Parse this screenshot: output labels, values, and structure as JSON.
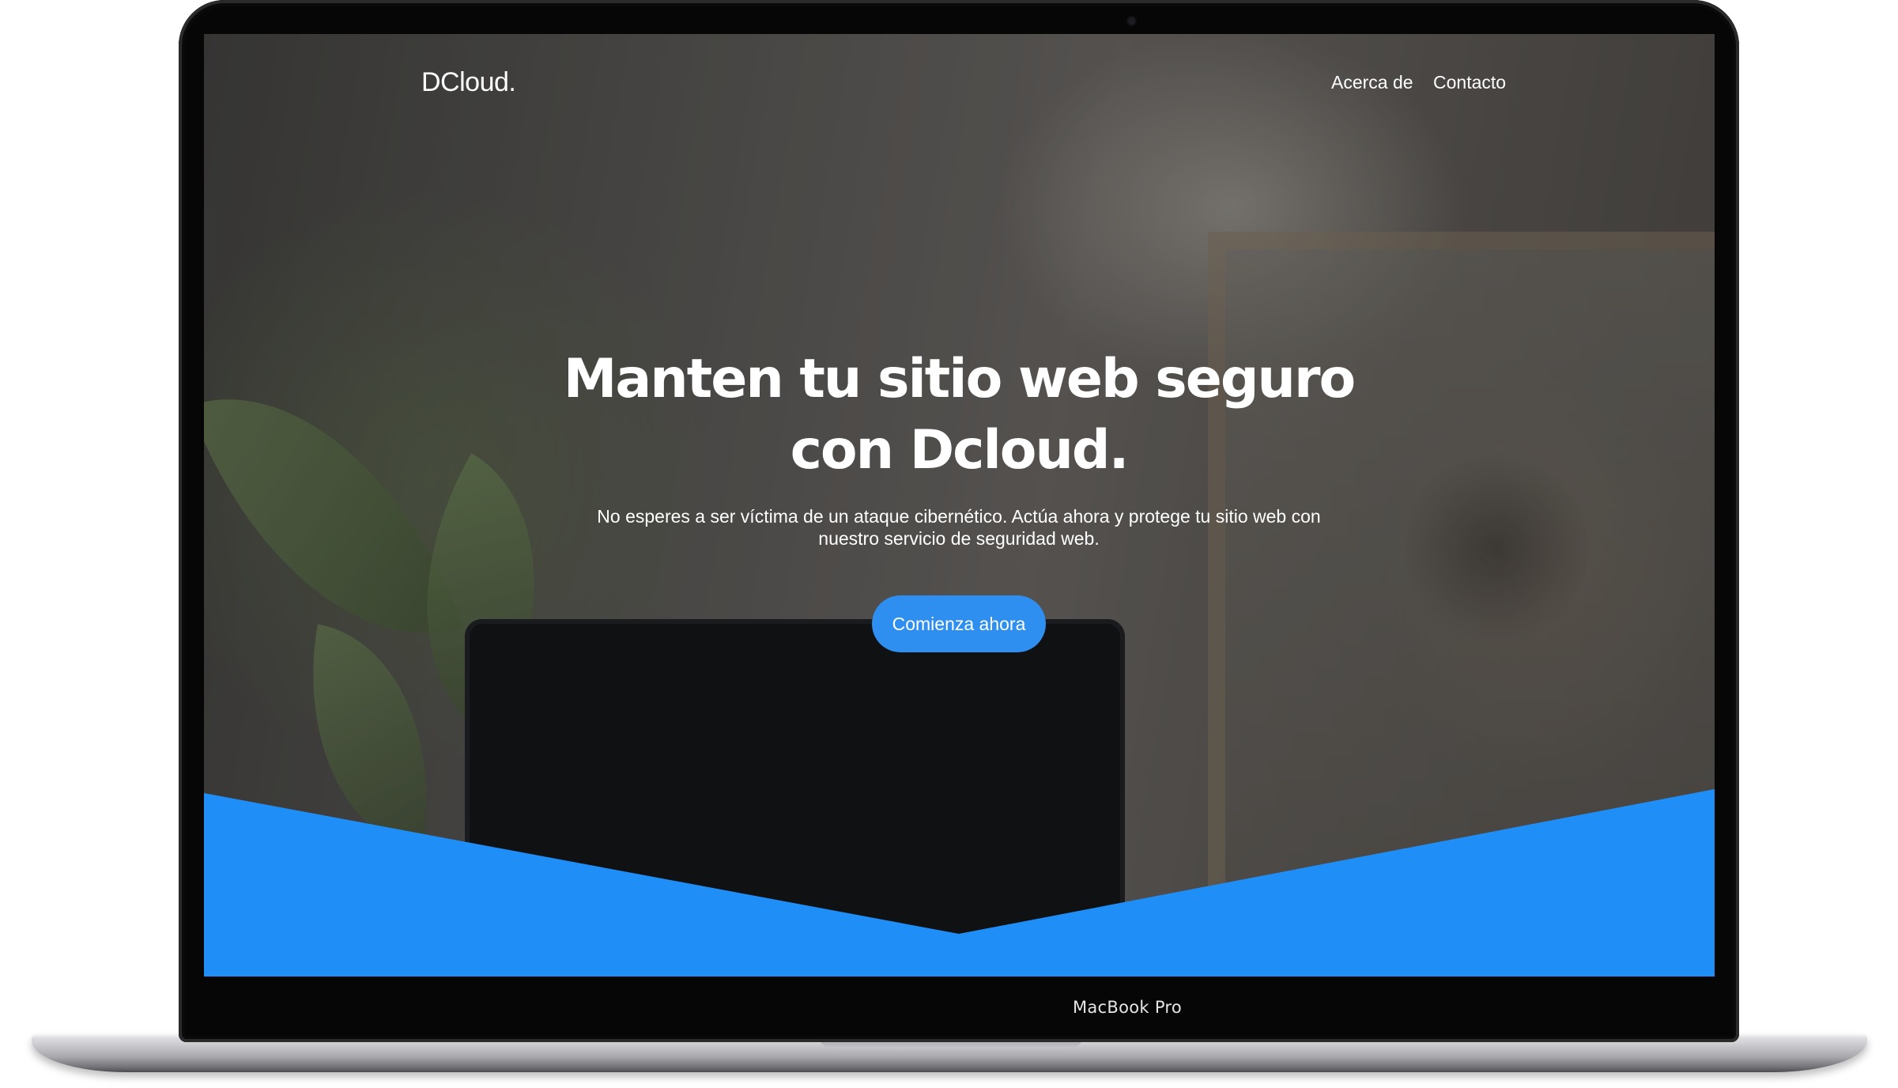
{
  "device": {
    "label": "MacBook Pro"
  },
  "site": {
    "brand": "DCloud.",
    "nav": [
      {
        "label": "Acerca de"
      },
      {
        "label": "Contacto"
      }
    ],
    "hero": {
      "title": "Manten tu sitio web seguro con Dcloud.",
      "subtitle": "No esperes a ser víctima de un ataque cibernético. Actúa ahora y protege tu sitio web con nuestro servicio de seguridad web.",
      "cta": "Comienza ahora"
    }
  },
  "colors": {
    "accent": "#1f8ff7",
    "button": "#2f8ff0",
    "bezel": "#060606",
    "text": "#ffffff"
  }
}
